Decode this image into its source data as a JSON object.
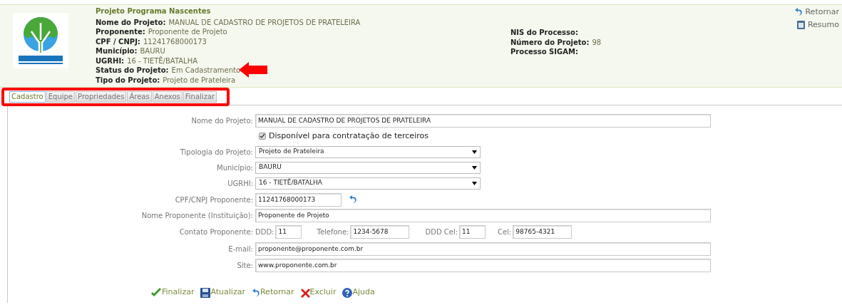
{
  "header": {
    "program": "Projeto Programa Nascentes",
    "left_fields": [
      {
        "label": "Nome do Projeto:",
        "value": "MANUAL DE CADASTRO DE PROJETOS DE PRATELEIRA"
      },
      {
        "label": "Proponente:",
        "value": "Proponente de Projeto"
      },
      {
        "label": "CPF / CNPJ:",
        "value": "11241768000173"
      },
      {
        "label": "Município:",
        "value": "BAURU"
      },
      {
        "label": "UGRHI:",
        "value": "16 - TIETÊ/BATALHA"
      },
      {
        "label": "Status do Projeto:",
        "value": "Em Cadastramento"
      },
      {
        "label": "Tipo do Projeto:",
        "value": "Projeto de Prateleira"
      }
    ],
    "right_fields": [
      {
        "label": "NIS do Processo:"
      },
      {
        "label": "Número do Projeto:",
        "value": "98"
      },
      {
        "label": "Processo SIGAM:"
      }
    ],
    "links": [
      {
        "kind": "back",
        "label": "Retornar"
      },
      {
        "kind": "summary",
        "label": "Resumo"
      }
    ]
  },
  "tabs": [
    {
      "label": "Cadastro",
      "selected": true
    },
    {
      "label": "Equipe",
      "selected": false
    },
    {
      "label": "Propriedades",
      "selected": false
    },
    {
      "label": "Áreas",
      "selected": false
    },
    {
      "label": "Anexos",
      "selected": false
    },
    {
      "label": "Finalizar",
      "selected": false
    }
  ],
  "form": [
    {
      "kind": "text",
      "label": "Nome do Projeto:",
      "value": "MANUAL DE CADASTRO DE PROJETOS DE PRATELEIRA"
    },
    {
      "kind": "checkbox",
      "label": "Disponível para contratação de terceiros",
      "checked": true
    },
    {
      "kind": "select",
      "label": "Tipologia do Projeto:",
      "value": "Projeto de Prateleira"
    },
    {
      "kind": "select",
      "label": "Município:",
      "value": "BAURU"
    },
    {
      "kind": "select",
      "label": "UGRHI:",
      "value": "16 - TIETÊ/BATALHA"
    },
    {
      "kind": "short",
      "label": "CPF/CNPJ Proponente:",
      "value": "11241768000173"
    },
    {
      "kind": "text",
      "label": "Nome Proponente (Instituição):",
      "value": "Proponente de Projeto"
    },
    {
      "kind": "contact",
      "label": "Contato Proponente:",
      "parts": [
        {
          "label": "DDD:",
          "value": "11"
        },
        {
          "label": "Telefone:",
          "value": "1234-5678"
        },
        {
          "label": "DDD Cel:",
          "value": "11"
        },
        {
          "label": "Cel:",
          "value": "98765-4321"
        }
      ]
    },
    {
      "kind": "text",
      "label": "E-mail:",
      "value": "proponente@proponente.com.br"
    },
    {
      "kind": "text",
      "label": "Site:",
      "value": "www.proponente.com.br"
    }
  ],
  "actions": [
    {
      "kind": "finish",
      "label": "Finalizar"
    },
    {
      "kind": "save",
      "label": "Atualizar"
    },
    {
      "kind": "back",
      "label": "Retornar"
    },
    {
      "kind": "delete",
      "label": "Excluir"
    },
    {
      "kind": "help",
      "label": "Ajuda"
    }
  ]
}
